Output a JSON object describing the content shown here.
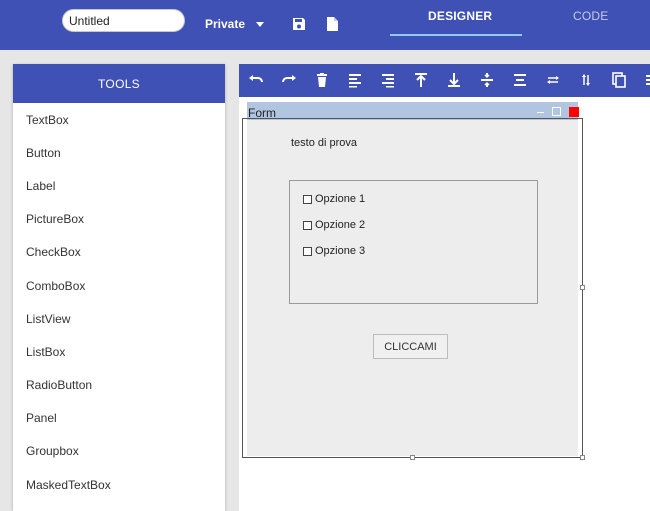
{
  "header": {
    "document_title": "Untitled",
    "privacy": "Private",
    "tabs": [
      {
        "label": "DESIGNER",
        "active": true
      },
      {
        "label": "CODE",
        "active": false
      }
    ],
    "icons": [
      "save-icon",
      "new-file-icon",
      "chevron-down-icon"
    ]
  },
  "tools": {
    "header": "TOOLS",
    "items": [
      "TextBox",
      "Button",
      "Label",
      "PictureBox",
      "CheckBox",
      "ComboBox",
      "ListView",
      "ListBox",
      "RadioButton",
      "Panel",
      "Groupbox",
      "MaskedTextBox"
    ]
  },
  "toolbar": {
    "buttons": [
      "undo-icon",
      "redo-icon",
      "delete-icon",
      "align-left-icon",
      "align-right-icon",
      "align-top-icon",
      "align-bottom-icon",
      "center-vertical-icon",
      "center-horizontal-icon",
      "same-width-icon",
      "same-height-icon",
      "copy-icon"
    ]
  },
  "form": {
    "title": "Form",
    "label_text": "testo di prova",
    "options": [
      "Opzione 1",
      "Opzione 2",
      "Opzione 3"
    ],
    "button_label": "CLICCAMI"
  },
  "colors": {
    "primary": "#3f51b5",
    "form_titlebar": "#b2c5e0",
    "close_button": "#ff0000",
    "form_background": "#ededed"
  }
}
